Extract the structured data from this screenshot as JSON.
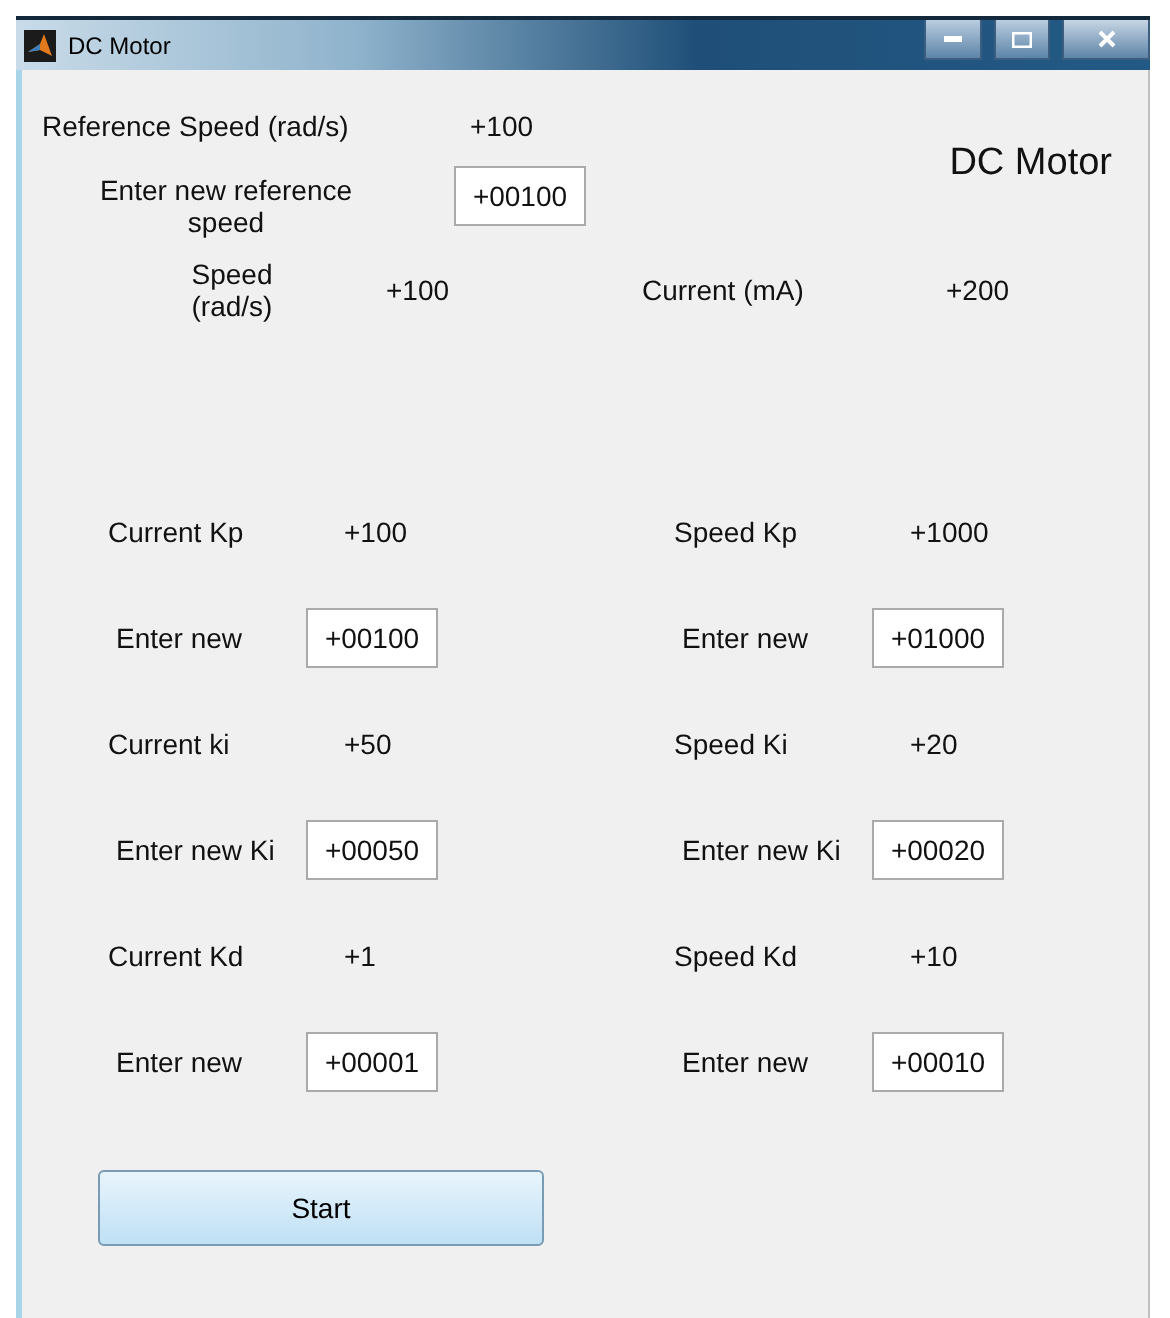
{
  "window": {
    "title": "DC Motor"
  },
  "reference": {
    "label": "Reference Speed (rad/s)",
    "value": "+100"
  },
  "heading": "DC Motor",
  "new_reference": {
    "label": "Enter new reference speed",
    "value": "+00100"
  },
  "readouts": [
    {
      "label": "Speed (rad/s)",
      "value": "+100"
    },
    {
      "label": "Current (mA)",
      "value": "+200"
    }
  ],
  "gain_panels": [
    {
      "rows": [
        {
          "kind": "reading",
          "label": "Current Kp",
          "value": "+100"
        },
        {
          "kind": "input",
          "label": "Enter new",
          "value": "+00100"
        },
        {
          "kind": "reading",
          "label": "Current ki",
          "value": "+50"
        },
        {
          "kind": "input",
          "label": "Enter new Ki",
          "value": "+00050"
        },
        {
          "kind": "reading",
          "label": "Current Kd",
          "value": "+1"
        },
        {
          "kind": "input",
          "label": "Enter new",
          "value": "+00001"
        }
      ]
    },
    {
      "rows": [
        {
          "kind": "reading",
          "label": "Speed Kp",
          "value": "+1000"
        },
        {
          "kind": "input",
          "label": "Enter new",
          "value": "+01000"
        },
        {
          "kind": "reading",
          "label": "Speed Ki",
          "value": "+20"
        },
        {
          "kind": "input",
          "label": "Enter new Ki",
          "value": "+00020"
        },
        {
          "kind": "reading",
          "label": "Speed Kd",
          "value": "+10"
        },
        {
          "kind": "input",
          "label": "Enter new",
          "value": "+00010"
        }
      ]
    }
  ],
  "start_button": "Start"
}
